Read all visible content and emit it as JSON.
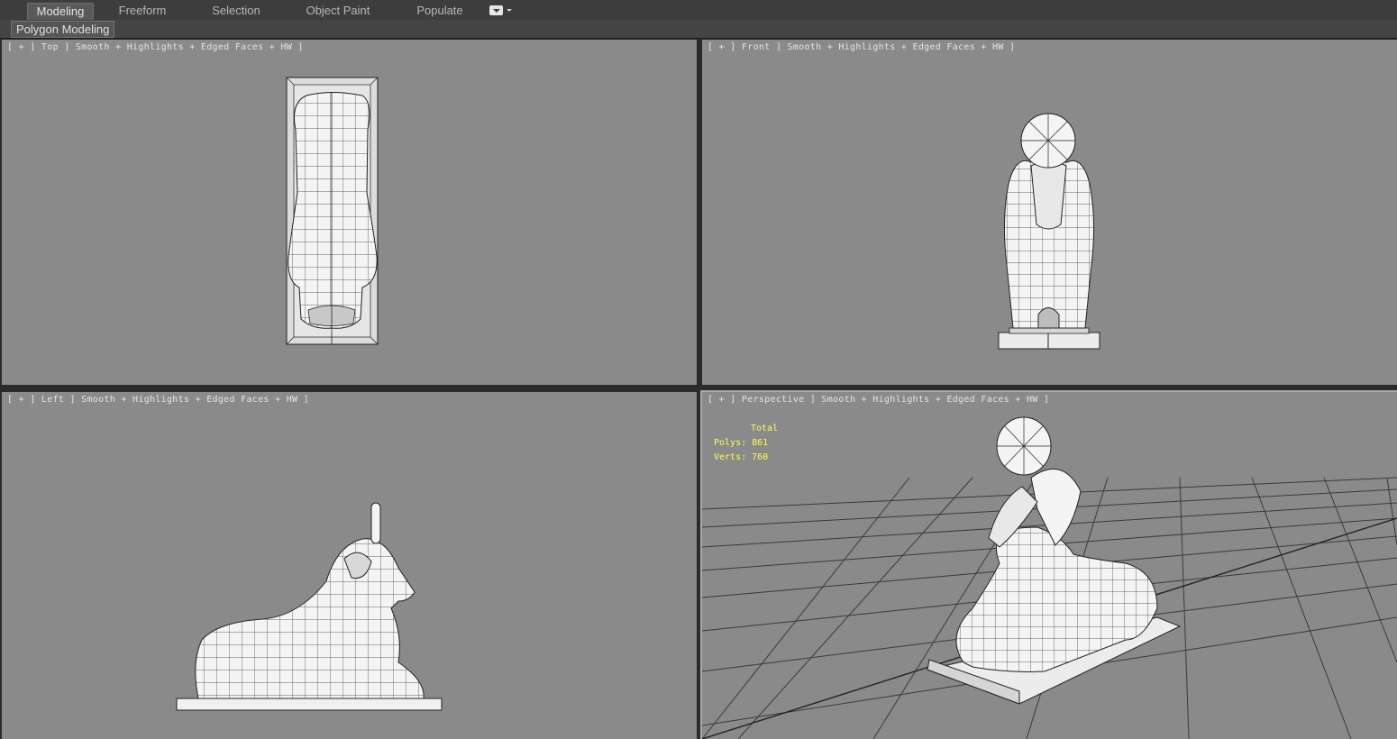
{
  "ribbon": {
    "tabs": [
      {
        "label": "Modeling",
        "active": true
      },
      {
        "label": "Freeform",
        "active": false
      },
      {
        "label": "Selection",
        "active": false
      },
      {
        "label": "Object Paint",
        "active": false
      },
      {
        "label": "Populate",
        "active": false
      }
    ],
    "panel_label": "Polygon Modeling"
  },
  "viewports": {
    "top": {
      "label": "[ + ] Top ] Smooth + Highlights + Edged Faces + HW ]"
    },
    "front": {
      "label": "[ + ] Front ] Smooth + Highlights + Edged Faces + HW ]"
    },
    "left": {
      "label": "[ + ] Left ] Smooth + Highlights + Edged Faces + HW ]"
    },
    "perspective": {
      "label": "[ + ] Perspective ] Smooth + Highlights + Edged Faces + HW ]",
      "stats": {
        "title": "Total",
        "polys": "Polys: 861",
        "verts": "Verts: 760"
      }
    }
  },
  "colors": {
    "viewport_bg": "#8a8a8a",
    "stats_text": "#ffff55",
    "mesh_fill": "#f2f2f2",
    "mesh_edge": "#222222"
  }
}
